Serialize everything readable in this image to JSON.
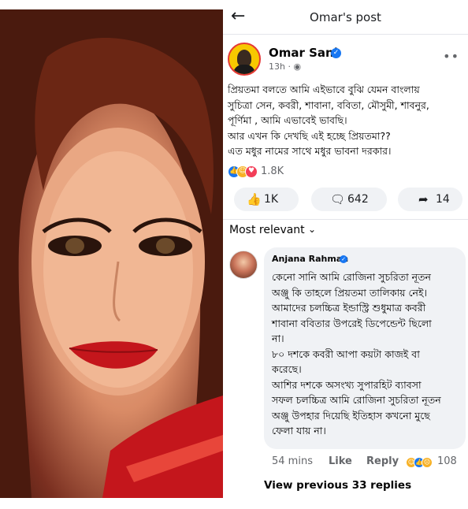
{
  "topbar": {
    "back_icon": "back-arrow-icon",
    "title": "Omar's post"
  },
  "post": {
    "author": "Omar Sani",
    "time": "13h",
    "audience_icon": "globe-icon",
    "text_lines": [
      "প্রিয়তমা বলতে আমি এইভাবে বুঝি যেমন বাংলায়",
      "সুচিত্রা সেন, কবরী, শাবানা, ববিতা, মৌসুমী, শাবনুর,",
      "পূর্ণিমা , আমি এভাবেই ভাবছি।",
      "আর এখন কি দেখছি এই হচ্ছে প্রিয়তমা??",
      "এত মধুর নামের সাথে মধুর ভাবনা দরকার।"
    ],
    "reaction_count": "1.8K",
    "like_count": "1K",
    "comment_count": "642",
    "share_count": "14"
  },
  "comments": {
    "sort_label": "Most relevant",
    "items": [
      {
        "author": "Anjana Rahman",
        "text_lines": [
          "কেনো সানি আমি রোজিনা সুচরিতা নূতন",
          "অঞ্জু কি তাহলে প্রিয়তমা তালিকায় নেই।",
          "আমাদের চলচ্চিত্র ইন্ডাস্ট্রি শুধুমাত্র কবরী",
          "শাবানা ববিতার উপরেই ডিপেন্ডেন্ট ছিলো",
          "না।",
          "৮০ দশকে কবরী আপা কয়টা কাজই বা",
          "করেছে।",
          "আশির দশকে অসংখ্য সুপারহিট ব্যাবসা",
          "সফল চলচ্চিত্র আমি রোজিনা সুচরিতা নূতন",
          "অঞ্জু উপহার দিয়েছি ইতিহাস কখনো মুছে",
          "ফেলা যায় না।"
        ],
        "time": "54 mins",
        "like_label": "Like",
        "reply_label": "Reply",
        "reaction_count": "108"
      }
    ],
    "view_previous": "View previous 33 replies"
  },
  "colors": {
    "brand_blue": "#1877f2",
    "button_bg": "#f0f2f5",
    "secondary_text": "#65676b"
  }
}
